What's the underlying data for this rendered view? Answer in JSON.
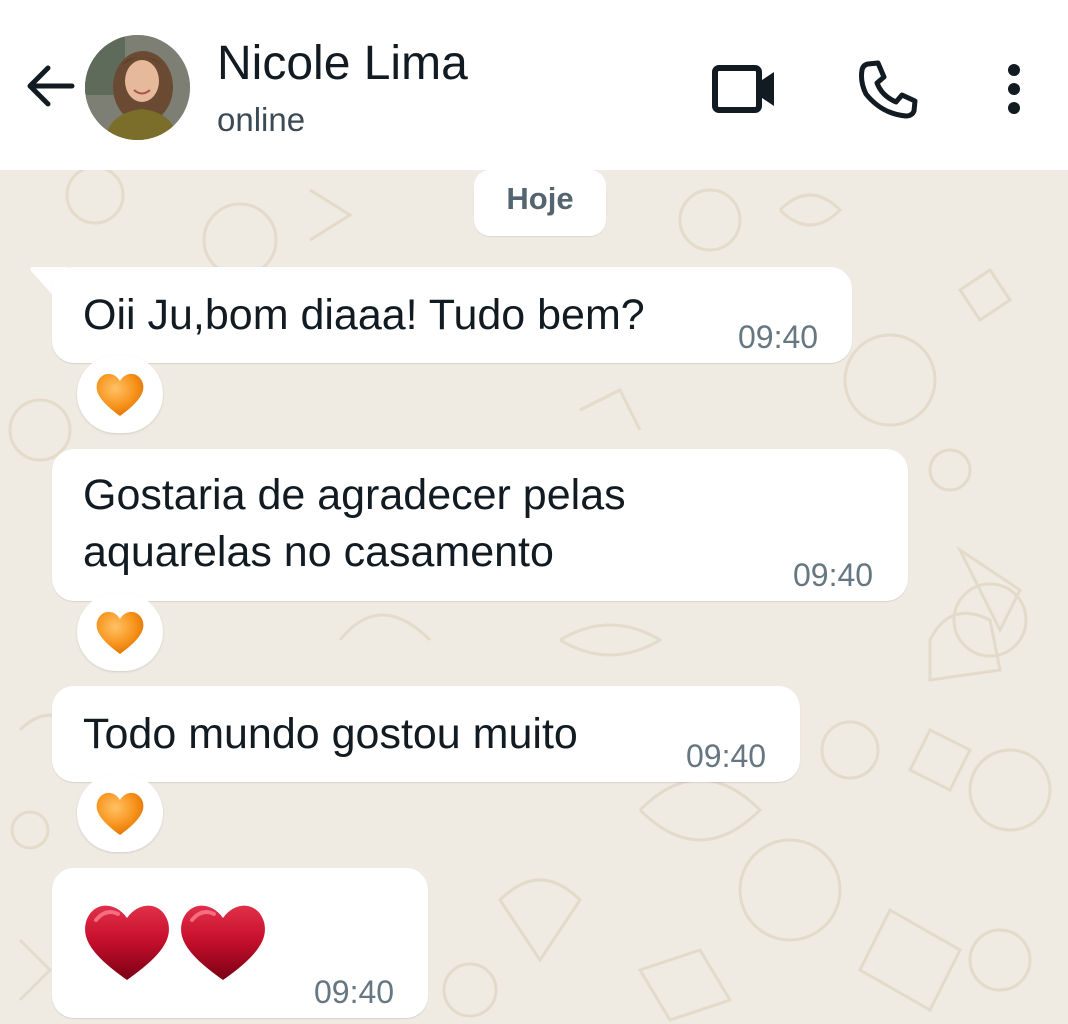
{
  "header": {
    "contact_name": "Nicole Lima",
    "status": "online",
    "icons": [
      "back-arrow-icon",
      "video-call-icon",
      "phone-call-icon",
      "more-options-icon"
    ]
  },
  "chat": {
    "date_separator": "Hoje",
    "messages": [
      {
        "lines": [
          "Oii Ju,bom diaaa! Tudo bem?"
        ],
        "time": "09:40",
        "reaction": "orange-heart"
      },
      {
        "lines": [
          "Gostaria de agradecer pelas",
          "aquarelas no casamento"
        ],
        "time": "09:40",
        "reaction": "orange-heart"
      },
      {
        "lines": [
          "Todo mundo gostou muito"
        ],
        "time": "09:40",
        "reaction": "orange-heart"
      },
      {
        "emoji": "red-heart red-heart",
        "time": "09:40"
      }
    ]
  },
  "colors": {
    "header_bg": "#ffffff",
    "chat_bg": "#efeae2",
    "bubble_bg": "#ffffff",
    "text": "#111b21",
    "timestamp": "#667781",
    "reaction_heart": "#f7941d",
    "heart_red": "#c8102e"
  }
}
